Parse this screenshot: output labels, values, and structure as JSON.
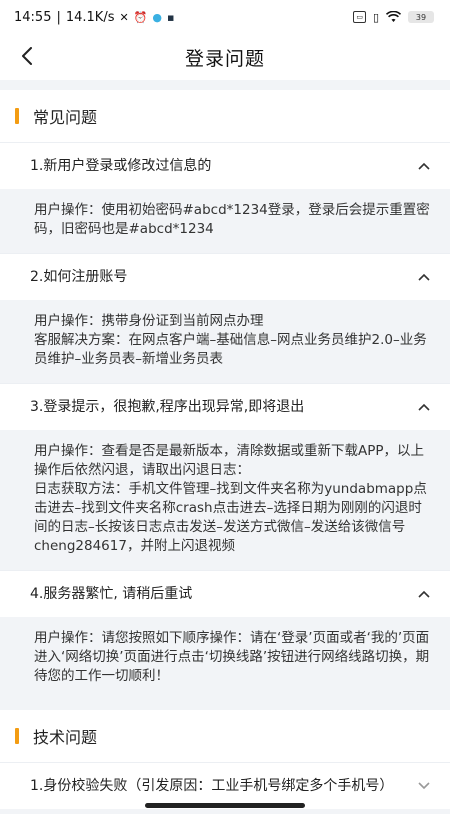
{
  "status_bar": {
    "time": "14:55",
    "speed": "14.1K/s",
    "battery": "39"
  },
  "nav": {
    "title": "登录问题"
  },
  "sections": [
    {
      "title": "常见问题",
      "items": [
        {
          "question": "1.新用户登录或修改过信息的",
          "answer": [
            "用户操作：使用初始密码#abcd*1234登录，登录后会提示重置密码，旧密码也是#abcd*1234"
          ]
        },
        {
          "question": "2.如何注册账号",
          "answer": [
            "用户操作：携带身份证到当前网点办理",
            "客服解决方案：在网点客户端–基础信息–网点业务员维护2.0–业务员维护–业务员表–新增业务员表"
          ]
        },
        {
          "question": "3.登录提示，很抱歉,程序出现异常,即将退出",
          "answer": [
            "用户操作：查看是否是最新版本，清除数据或重新下载APP，以上操作后依然闪退，请取出闪退日志：",
            "日志获取方法：手机文件管理–找到文件夹名称为yundabmapp点击进去–找到文件夹名称crash点击进去–选择日期为刚刚的闪退时间的日志–长按该日志点击发送–发送方式微信–发送给该微信号cheng284617，并附上闪退视频"
          ]
        },
        {
          "question": "4.服务器繁忙, 请稍后重试",
          "answer": [
            "用户操作：请您按照如下顺序操作：请在‘登录’页面或者‘我的’页面进入‘网络切换’页面进行点击‘切换线路’按钮进行网络线路切换，期待您的工作一切顺利！"
          ]
        }
      ]
    },
    {
      "title": "技术问题",
      "items": [
        {
          "question": "1.身份校验失败（引发原因：工业手机号绑定多个手机号）",
          "answer": []
        }
      ]
    }
  ]
}
